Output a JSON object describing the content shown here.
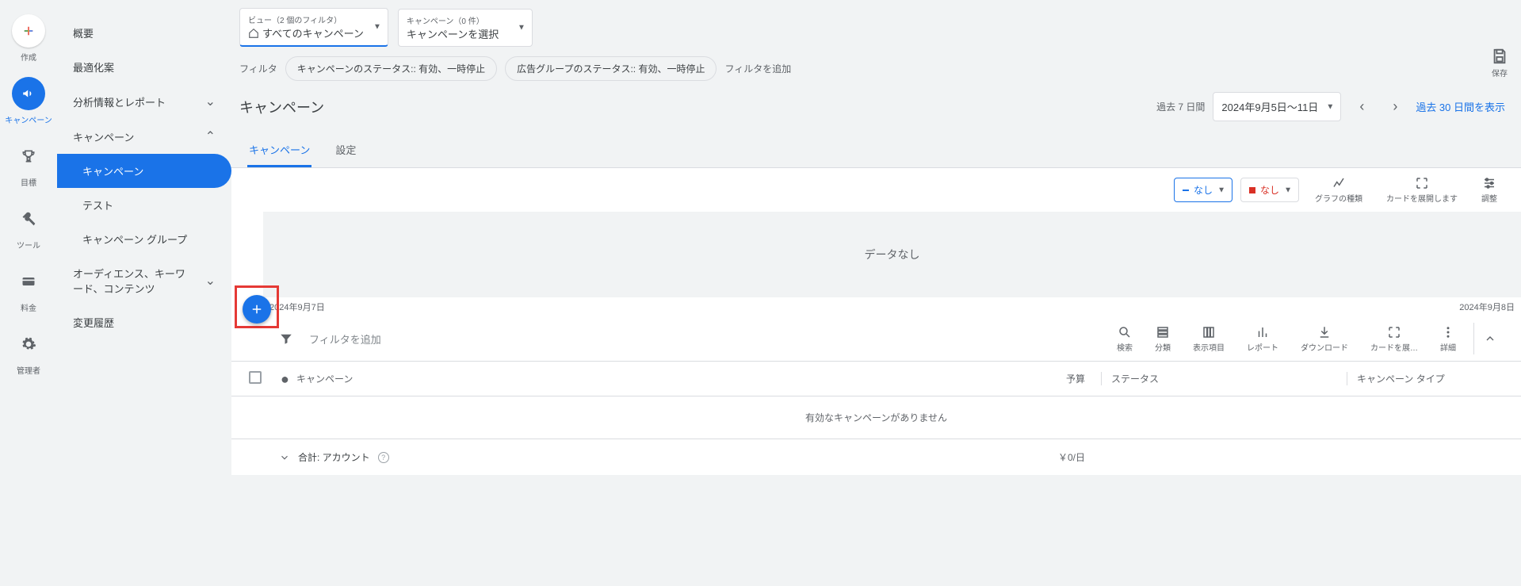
{
  "rail": {
    "create": "作成",
    "campaign": "キャンペーン",
    "goal": "目標",
    "tools": "ツール",
    "billing": "料金",
    "admin": "管理者"
  },
  "sidebar": {
    "overview": "概要",
    "optimization": "最適化案",
    "analysis": "分析情報とレポート",
    "campaigns_group": "キャンペーン",
    "sub_campaigns": "キャンペーン",
    "sub_test": "テスト",
    "sub_groups": "キャンペーン グループ",
    "audience": "オーディエンス、キーワード、コンテンツ",
    "history": "変更履歴"
  },
  "selectors": {
    "view_small": "ビュー（2 個のフィルタ）",
    "view_main": "すべてのキャンペーン",
    "camp_small": "キャンペーン（0 件）",
    "camp_main": "キャンペーンを選択"
  },
  "filters": {
    "label": "フィルタ",
    "chip1": "キャンペーンのステータス:: 有効、一時停止",
    "chip2": "広告グループのステータス:: 有効、一時停止",
    "add": "フィルタを追加"
  },
  "save": "保存",
  "page_title": "キャンペーン",
  "date": {
    "range_label": "過去 7 日間",
    "range_value": "2024年9月5日～11日",
    "long_link": "過去 30 日間を表示"
  },
  "tabs": {
    "campaign": "キャンペーン",
    "settings": "設定"
  },
  "seg": {
    "none1": "なし",
    "none2": "なし"
  },
  "tools": {
    "chart": "グラフの種類",
    "expand_card": "カードを展開します",
    "adjust": "調整",
    "search": "検索",
    "category": "分類",
    "columns": "表示項目",
    "report": "レポート",
    "download": "ダウンロード",
    "expand_card2": "カードを展…",
    "detail": "詳細"
  },
  "chart": {
    "no_data": "データなし",
    "date_left": "2024年9月7日",
    "date_right": "2024年9月8日"
  },
  "table": {
    "filter_placeholder": "フィルタを追加",
    "col_campaign": "キャンペーン",
    "col_budget": "予算",
    "col_status": "ステータス",
    "col_type": "キャンペーン タイプ",
    "empty": "有効なキャンペーンがありません",
    "total_label": "合計: アカウント",
    "total_budget": "￥0/日"
  }
}
